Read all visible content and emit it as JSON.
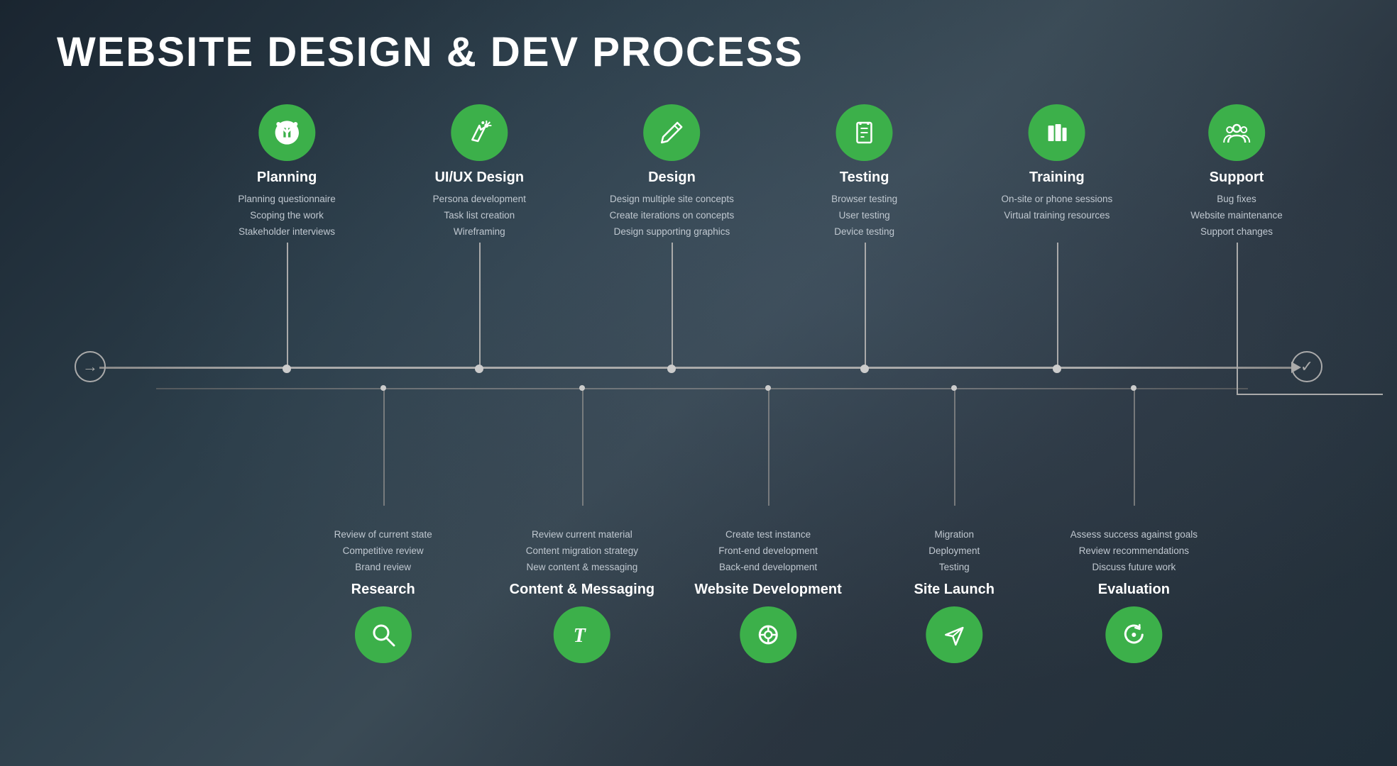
{
  "title": "WEBSITE DESIGN & DEV PROCESS",
  "colors": {
    "green": "#3cb04a",
    "text": "white",
    "detail": "#c0c8d0",
    "line": "#aaa"
  },
  "top_items": [
    {
      "id": "planning",
      "label": "Planning",
      "icon": "fork-icon",
      "details": [
        "Planning questionnaire",
        "Scoping the work",
        "Stakeholder interviews"
      ],
      "x_pct": 16
    },
    {
      "id": "uiux",
      "label": "UI/UX Design",
      "icon": "magic-icon",
      "details": [
        "Persona development",
        "Task list creation",
        "Wireframing"
      ],
      "x_pct": 30
    },
    {
      "id": "design",
      "label": "Design",
      "icon": "pen-icon",
      "details": [
        "Design multiple site concepts",
        "Create iterations on concepts",
        "Design supporting graphics"
      ],
      "x_pct": 44
    },
    {
      "id": "testing",
      "label": "Testing",
      "icon": "clipboard-icon",
      "details": [
        "Browser testing",
        "User testing",
        "Device testing"
      ],
      "x_pct": 58
    },
    {
      "id": "training",
      "label": "Training",
      "icon": "books-icon",
      "details": [
        "On-site or phone sessions",
        "Virtual training resources"
      ],
      "x_pct": 72
    },
    {
      "id": "support",
      "label": "Support",
      "icon": "people-icon",
      "details": [
        "Bug fixes",
        "Website maintenance",
        "Support changes"
      ],
      "x_pct": 86
    }
  ],
  "bottom_items": [
    {
      "id": "research",
      "label": "Research",
      "icon": "search-icon",
      "details": [
        "Review of current state",
        "Competitive review",
        "Brand review"
      ],
      "x_pct": 22
    },
    {
      "id": "content",
      "label": "Content & Messaging",
      "icon": "type-icon",
      "details": [
        "Review current material",
        "Content migration strategy",
        "New content & messaging"
      ],
      "x_pct": 36
    },
    {
      "id": "webdev",
      "label": "Website Development",
      "icon": "gear-icon",
      "details": [
        "Create test instance",
        "Front-end development",
        "Back-end development"
      ],
      "x_pct": 50
    },
    {
      "id": "launch",
      "label": "Site Launch",
      "icon": "send-icon",
      "details": [
        "Migration",
        "Deployment",
        "Testing"
      ],
      "x_pct": 64
    },
    {
      "id": "evaluation",
      "label": "Evaluation",
      "icon": "refresh-icon",
      "details": [
        "Assess success against goals",
        "Review recommendations",
        "Discuss future work"
      ],
      "x_pct": 78
    }
  ],
  "start_icon": "→",
  "end_icon": "✓"
}
